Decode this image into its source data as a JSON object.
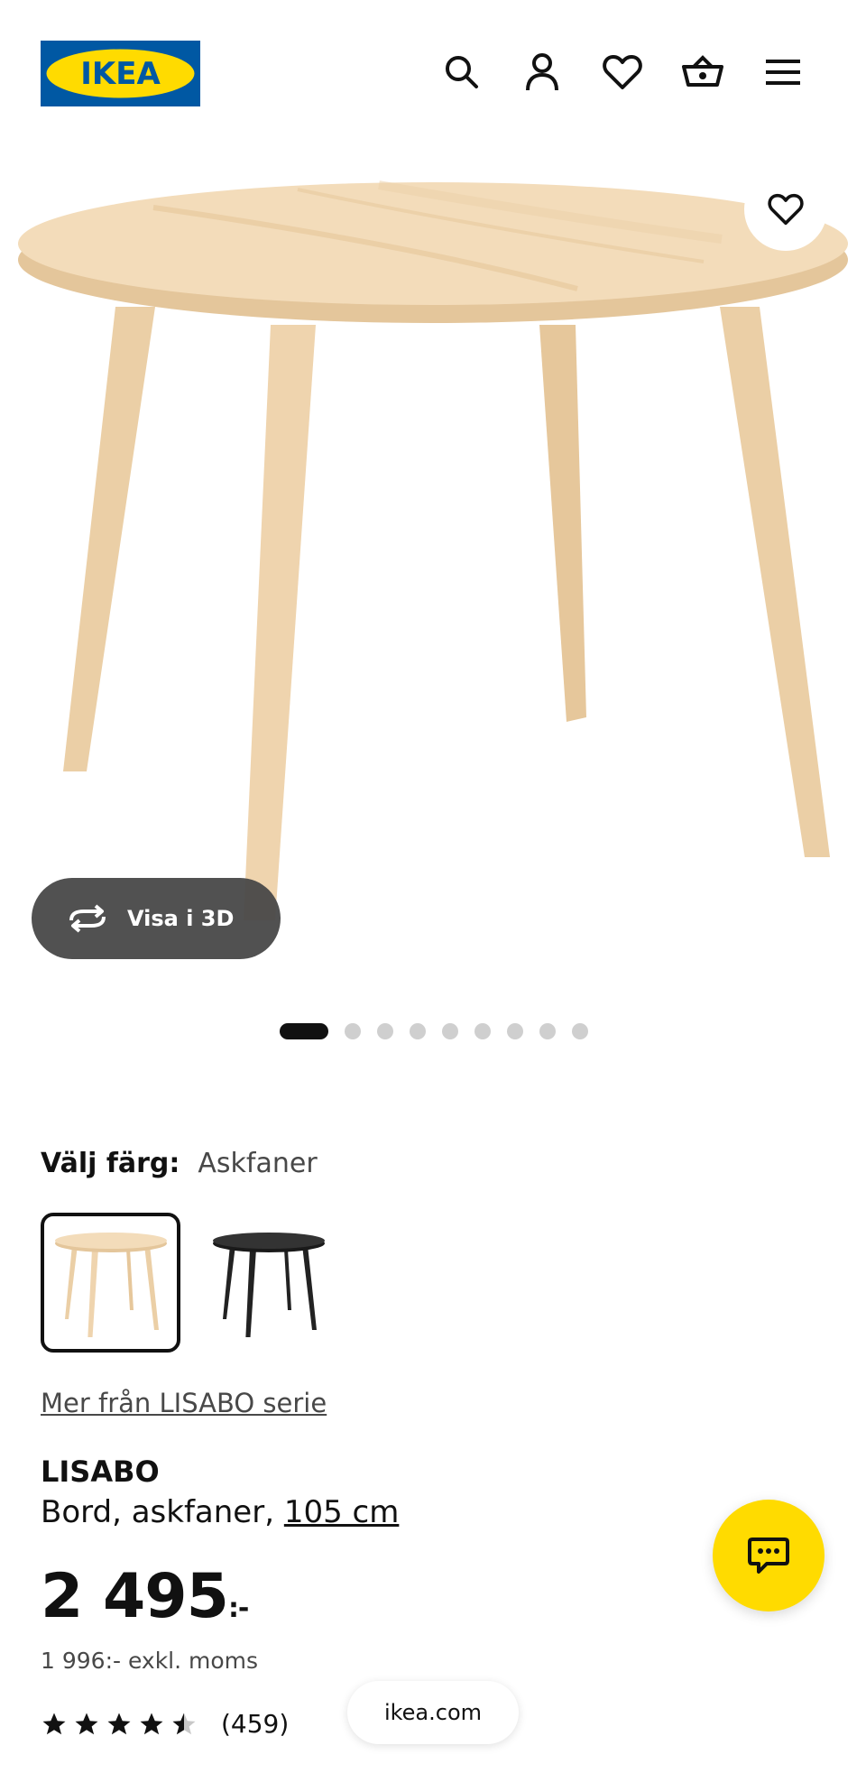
{
  "header": {
    "logo_text": "IKEA",
    "icons": [
      "search-icon",
      "account-icon",
      "favourites-icon",
      "cart-icon",
      "menu-icon"
    ]
  },
  "gallery": {
    "view_3d_label": "Visa i 3D",
    "slide_count": 9,
    "active_slide": 1
  },
  "color": {
    "label": "Välj färg:",
    "selected": "Askfaner",
    "options": [
      "ash-veneer",
      "black"
    ]
  },
  "series_link": "Mer från LISABO serie",
  "product": {
    "name": "LISABO",
    "description": "Bord, askfaner,",
    "size": "105 cm"
  },
  "price": {
    "amount": "2 495",
    "suffix": ":-",
    "excl_vat": "1 996:- exkl. moms"
  },
  "rating": {
    "stars": 4.5,
    "count": "(459)"
  },
  "browser": {
    "url": "ikea.com"
  },
  "colors": {
    "ikea_blue": "#0058a3",
    "ikea_yellow": "#ffdb00",
    "wood": "#ecd2ae"
  }
}
